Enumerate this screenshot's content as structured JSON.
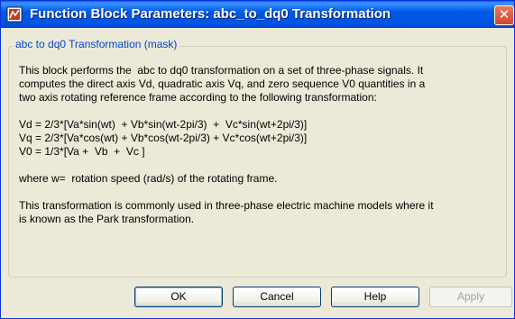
{
  "window": {
    "title": "Function Block Parameters: abc_to_dq0 Transformation",
    "close_glyph": "✕"
  },
  "group": {
    "title": "abc to dq0 Transformation (mask)"
  },
  "description": {
    "para1_line1": "This block performs the  abc to dq0 transformation on a set of three-phase signals. It",
    "para1_line2": "computes the direct axis Vd, quadratic axis Vq, and zero sequence V0 quantities in a",
    "para1_line3": "two axis rotating reference frame according to the following transformation:",
    "eq1": "Vd = 2/3*[Va*sin(wt)  + Vb*sin(wt-2pi/3)  +  Vc*sin(wt+2pi/3)]",
    "eq2": "Vq = 2/3*[Va*cos(wt) + Vb*cos(wt-2pi/3) + Vc*cos(wt+2pi/3)]",
    "eq3": "V0 = 1/3*[Va +  Vb  +  Vc ]",
    "where": "where w=  rotation speed (rad/s) of the rotating frame.",
    "para3_line1": "This transformation is commonly used in three-phase electric machine models where it",
    "para3_line2": "is known as the Park transformation."
  },
  "buttons": {
    "ok": "OK",
    "cancel": "Cancel",
    "help": "Help",
    "apply": "Apply"
  },
  "icons": {
    "title": "simulink-block-icon",
    "close": "close-icon"
  },
  "colors": {
    "titlebar": "#0054e3",
    "group_title": "#0046d5",
    "close": "#d4452b"
  }
}
